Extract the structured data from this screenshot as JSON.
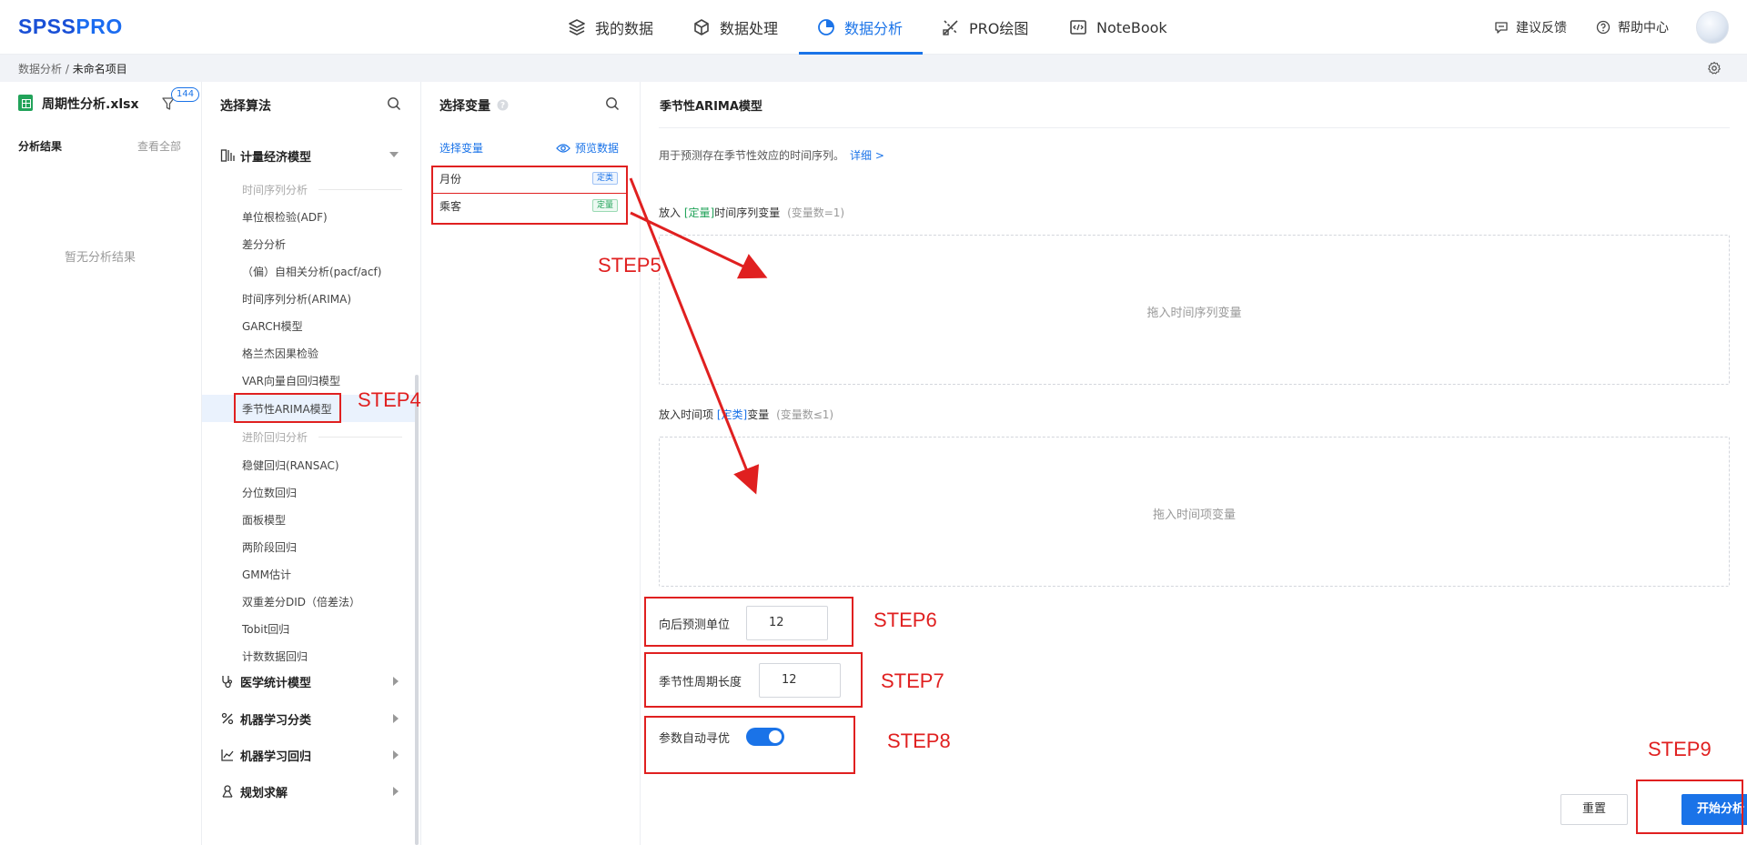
{
  "app": {
    "logo_main": "SPSS",
    "logo_pro": "PRO"
  },
  "nav": {
    "items": [
      {
        "label": "我的数据",
        "icon": "layers-icon"
      },
      {
        "label": "数据处理",
        "icon": "cube-icon"
      },
      {
        "label": "数据分析",
        "icon": "pie-chart-icon",
        "active": true
      },
      {
        "label": "PRO绘图",
        "icon": "brush-ruler-icon"
      },
      {
        "label": "NoteBook",
        "icon": "code-icon"
      }
    ],
    "feedback": "建议反馈",
    "help": "帮助中心"
  },
  "breadcrumb": {
    "parent": "数据分析",
    "separator": "/",
    "current": "未命名项目"
  },
  "results_panel": {
    "file_name": "周期性分析.xlsx",
    "filter_count": "144",
    "results_label": "分析结果",
    "view_all": "查看全部",
    "empty_text": "暂无分析结果"
  },
  "algo_panel": {
    "title": "选择算法",
    "category_open": "计量经济模型",
    "sub_heads": [
      "时间序列分析",
      "进阶回归分析"
    ],
    "ts_items": [
      "单位根检验(ADF)",
      "差分分析",
      "（偏）自相关分析(pacf/acf)",
      "时间序列分析(ARIMA)",
      "GARCH模型",
      "格兰杰因果检验",
      "VAR向量自回归模型",
      "季节性ARIMA模型"
    ],
    "reg_items": [
      "稳健回归(RANSAC)",
      "分位数回归",
      "面板模型",
      "两阶段回归",
      "GMM估计",
      "双重差分DID（倍差法）",
      "Tobit回归",
      "计数数据回归"
    ],
    "categories_closed": [
      "医学统计模型",
      "机器学习分类",
      "机器学习回归",
      "规划求解"
    ]
  },
  "vars_panel": {
    "title": "选择变量",
    "tab": "选择变量",
    "preview": "预览数据",
    "variables": [
      {
        "name": "月份",
        "tag": "定类",
        "tag_color": "#1a73e8"
      },
      {
        "name": "乘客",
        "tag": "定量",
        "tag_color": "#22a35a"
      }
    ]
  },
  "config_panel": {
    "title": "季节性ARIMA模型",
    "description": "用于预测存在季节性效应的时间序列。",
    "detail_link": "详细 >",
    "ts_field": {
      "prefix": "放入",
      "type": "[定量]",
      "name": "时间序列变量",
      "hint": "(变量数=1)",
      "drop_text": "拖入时间序列变量"
    },
    "time_field": {
      "prefix": "放入时间项",
      "type": "[定类]",
      "name": "变量",
      "hint": "(变量数≤1)",
      "drop_text": "拖入时间项变量"
    },
    "forecast_label": "向后预测单位",
    "forecast_value": "12",
    "season_label": "季节性周期长度",
    "season_value": "12",
    "auto_label": "参数自动寻优",
    "auto_enabled": true,
    "reset_label": "重置",
    "start_label": "开始分析"
  },
  "annotations": {
    "color": "#e02020",
    "steps": [
      "STEP4",
      "STEP5",
      "STEP6",
      "STEP7",
      "STEP8",
      "STEP9"
    ]
  }
}
